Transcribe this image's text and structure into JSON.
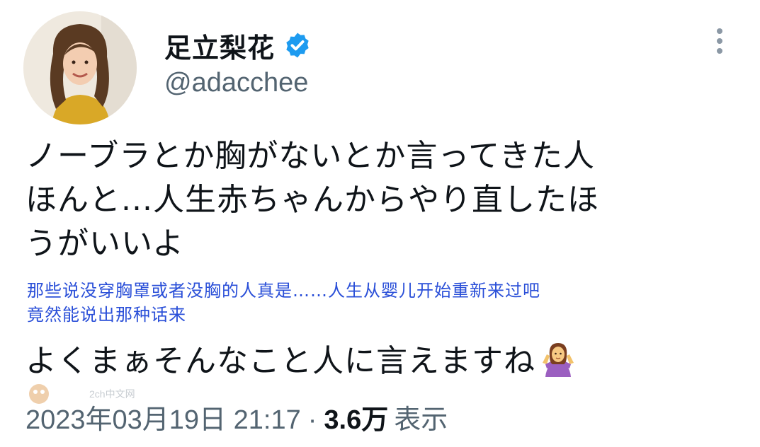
{
  "user": {
    "display_name": "足立梨花",
    "handle": "@adacchee",
    "verified": true
  },
  "tweet": {
    "text_line1": "ノーブラとか胸がないとか言ってきた人",
    "text_line2": "ほんと...人生赤ちゃんからやり直したほ",
    "text_line3": "うがいいよ",
    "translation_line1": "那些说没穿胸罩或者没胸的人真是……人生从婴儿开始重新来过吧",
    "translation_line2": "竟然能说出那种话来",
    "text_line4": "よくまぁそんなこと人に言えますね"
  },
  "meta": {
    "datetime": "2023年03月19日 21:17",
    "separator": "·",
    "views_count": "3.6万",
    "views_label": "表示"
  },
  "watermark": {
    "text": "2ch中文网"
  },
  "colors": {
    "translation": "#2a4fd8",
    "verified_badge": "#1d9bf0",
    "secondary_text": "#536471"
  },
  "icons": {
    "more": "more-vertical-icon",
    "verified": "verified-badge-icon",
    "emoji": "person-shrugging-emoji"
  }
}
